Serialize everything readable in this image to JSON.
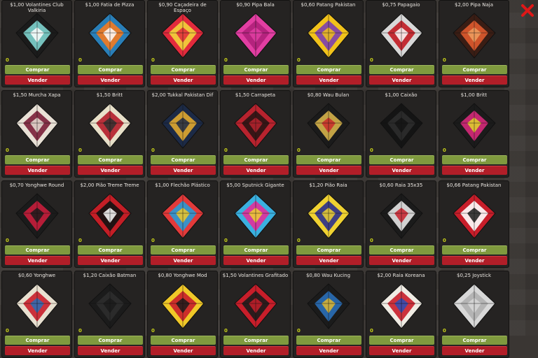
{
  "buttons": {
    "buy_label": "Comprar",
    "sell_label": "Vender"
  },
  "close_icon": "close-icon",
  "colors": {
    "buy": "#7f9a3e",
    "sell": "#b21e28",
    "quantity": "#c9d11a",
    "card": "#252322",
    "close": "#e01818"
  },
  "items": [
    {
      "title": "$1,00 Volantines Club Valkiria",
      "qty": "0",
      "art": [
        "#1b1b1b",
        "#7fd4cf",
        "#ffffff"
      ]
    },
    {
      "title": "$1,00 Fatia de Pizza",
      "qty": "0",
      "art": [
        "#2a7fb8",
        "#f47b20",
        "#ffffff"
      ]
    },
    {
      "title": "$0,90 Caçadeira de Espaço",
      "qty": "0",
      "art": [
        "#e22a3c",
        "#f3d33b",
        "#e22a3c"
      ]
    },
    {
      "title": "$0,90 Pipa Bala",
      "qty": "0",
      "art": [
        "#e23ea2",
        "#b0207a",
        "#e23ea2"
      ]
    },
    {
      "title": "$0,60 Patang Pakistan",
      "qty": "0",
      "art": [
        "#f1c21b",
        "#7b3fb0",
        "#f1c21b"
      ]
    },
    {
      "title": "$0,75 Papagaio",
      "qty": "0",
      "art": [
        "#d8d8d8",
        "#c11b22",
        "#ffffff"
      ]
    },
    {
      "title": "$2,00 Pipa Naja",
      "qty": "0",
      "art": [
        "#3a1d14",
        "#e05b2e",
        "#f0a060"
      ]
    },
    {
      "title": "$1,50 Murcha Xapa",
      "qty": "0",
      "art": [
        "#e9e1d6",
        "#7a1f38",
        "#e9e1d6"
      ]
    },
    {
      "title": "$1,50 Britt",
      "qty": "0",
      "art": [
        "#e8e0c9",
        "#b41d2a",
        "#303030"
      ]
    },
    {
      "title": "$2,00 Tukkal Pakistan Dif",
      "qty": "0",
      "art": [
        "#1c2a46",
        "#e0a830",
        "#1c2a46"
      ]
    },
    {
      "title": "$1,50 Carrapeta",
      "qty": "0",
      "art": [
        "#b8232e",
        "#2a1414",
        "#b8232e"
      ]
    },
    {
      "title": "$0,80 Wau Bulan",
      "qty": "0",
      "art": [
        "#1b1b1b",
        "#d6b24a",
        "#c92a2a"
      ]
    },
    {
      "title": "$1,00 Caixão",
      "qty": "0",
      "art": [
        "#141414",
        "#2c2c2c",
        "#141414"
      ]
    },
    {
      "title": "$1,00 Britt",
      "qty": "0",
      "art": [
        "#1b1b1b",
        "#d62a7a",
        "#e2d62a"
      ]
    },
    {
      "title": "$0,70 Yonghwe Round",
      "qty": "0",
      "art": [
        "#1b1b1b",
        "#c81e3c",
        "#1b1b1b"
      ]
    },
    {
      "title": "$2,00 Pião Treme Treme",
      "qty": "0",
      "art": [
        "#c41e26",
        "#111111",
        "#ffffff"
      ]
    },
    {
      "title": "$1,00 Flechão Plástico",
      "qty": "0",
      "art": [
        "#e23a3a",
        "#2a9bd6",
        "#f0c828"
      ]
    },
    {
      "title": "$5,00 Sputnick Gigante",
      "qty": "0",
      "art": [
        "#3ab0e0",
        "#e2309a",
        "#f0d030"
      ]
    },
    {
      "title": "$1,20 Pião Raia",
      "qty": "0",
      "art": [
        "#f0d232",
        "#2a2f8c",
        "#f0d232"
      ]
    },
    {
      "title": "$0,60 Raia 35x35",
      "qty": "0",
      "art": [
        "#1b1b1b",
        "#e6e6e6",
        "#c81e2a"
      ]
    },
    {
      "title": "$0,66 Patang Pakistan",
      "qty": "0",
      "art": [
        "#c81e2a",
        "#ffffff",
        "#1b1b1b"
      ]
    },
    {
      "title": "$0,60 Yonghwe",
      "qty": "0",
      "art": [
        "#e8e0d0",
        "#c81e2a",
        "#2a6fb8"
      ]
    },
    {
      "title": "$1,20 Caixão Batman",
      "qty": "0",
      "art": [
        "#1b1b1b",
        "#2e2e2e",
        "#1b1b1b"
      ]
    },
    {
      "title": "$0,80 Yonghwe Mod",
      "qty": "0",
      "art": [
        "#f0c828",
        "#c81e2a",
        "#1b1b1b"
      ]
    },
    {
      "title": "$1,50 Volantines Grafitado",
      "qty": "0",
      "art": [
        "#c81e2a",
        "#1b1b1b",
        "#c81e2a"
      ]
    },
    {
      "title": "$0,80 Wau Kucing",
      "qty": "0",
      "art": [
        "#1b1b1b",
        "#2a6fb8",
        "#e0b830"
      ]
    },
    {
      "title": "$2,00 Raia Koreana",
      "qty": "0",
      "art": [
        "#f0ece4",
        "#c81e2a",
        "#2a4fb8"
      ]
    },
    {
      "title": "$0,25 Joystick",
      "qty": "0",
      "art": [
        "#d8d8d8",
        "#b0b0b0",
        "#d8d8d8"
      ]
    }
  ]
}
